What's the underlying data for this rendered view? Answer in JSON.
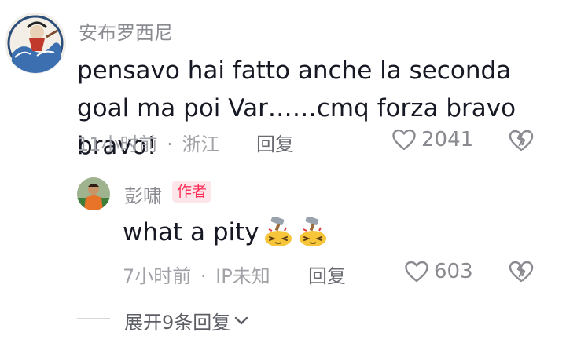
{
  "comment": {
    "username": "安布罗西尼",
    "text": "pensavo hai fatto anche la seconda goal ma poi Var……cmq forza bravo bravo!",
    "time": "11小时前",
    "separator": "·",
    "location": "浙江",
    "reply_label": "回复",
    "like_count": "2041",
    "icons": {
      "like": "heart-outline-icon",
      "dislike": "broken-heart-icon"
    }
  },
  "reply": {
    "username": "彭啸",
    "badge": "作者",
    "text": "what a pity",
    "time": "7小时前",
    "separator": "·",
    "location": "IP未知",
    "reply_label": "回复",
    "like_count": "603",
    "emojis": [
      "hammer-head-emoji",
      "hammer-head-emoji"
    ]
  },
  "expand": {
    "label": "展开9条回复",
    "icon": "chevron-down-icon"
  },
  "colors": {
    "text_primary": "#161823",
    "text_secondary": "#8a8b91",
    "badge_bg": "#fce6ea",
    "badge_fg": "#fe2c55"
  }
}
